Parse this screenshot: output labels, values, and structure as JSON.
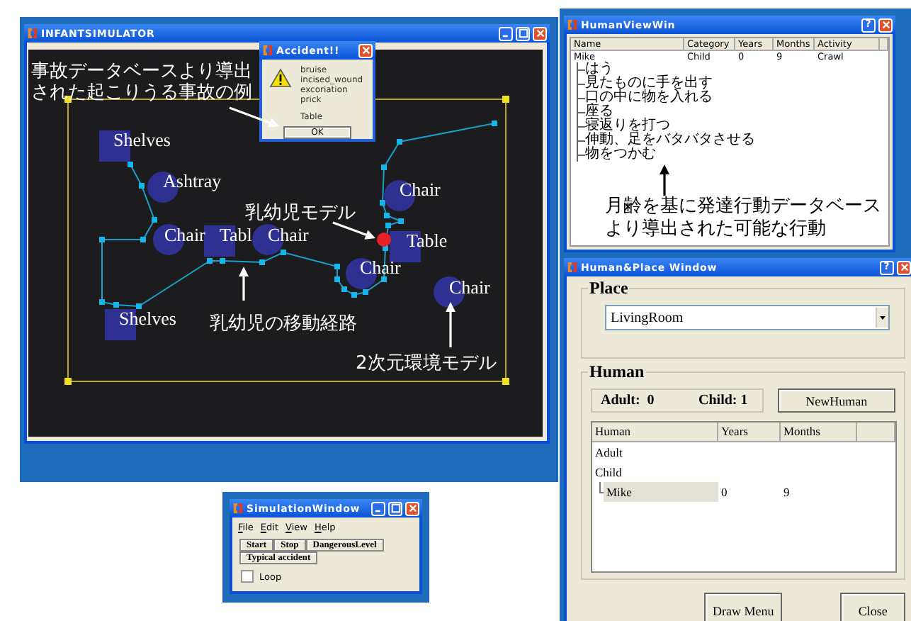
{
  "infant_simulator": {
    "title": "INFANTSIMULATOR",
    "objects": [
      {
        "kind": "square",
        "label": "Shelves"
      },
      {
        "kind": "circle",
        "label": "Ashtray"
      },
      {
        "kind": "circle",
        "label": "Chair"
      },
      {
        "kind": "square",
        "label": "Tabl"
      },
      {
        "kind": "circle",
        "label": "Chair"
      },
      {
        "kind": "circle",
        "label": "Chair"
      },
      {
        "kind": "square",
        "label": "Table"
      },
      {
        "kind": "circle",
        "label": "Chair"
      },
      {
        "kind": "circle",
        "label": "Chair"
      },
      {
        "kind": "square",
        "label": "Shelves"
      }
    ],
    "annotations": [
      "事故データベースより導出",
      "された起こりうる事故の例",
      "乳幼児モデル",
      "乳幼児の移動経路",
      "2次元環境モデル"
    ]
  },
  "accident_dialog": {
    "title": "Accident!!",
    "injuries": [
      "bruise",
      "incised_wound",
      "excoriation",
      "prick"
    ],
    "object": "Table",
    "ok_button": "OK"
  },
  "human_view_win": {
    "title": "HumanViewWin",
    "help_button": "?",
    "columns": [
      "Name",
      "Category",
      "Years",
      "Months",
      "Activity"
    ],
    "rows": [
      {
        "cells": [
          "Mike",
          "Child",
          "0",
          "9",
          "Crawl"
        ],
        "children": [
          "はう",
          "見たものに手を出す",
          "口の中に物を入れる",
          "座る",
          "寝返りを打つ",
          "伸動、足をバタバタさせる",
          "物をつかむ"
        ]
      }
    ],
    "annotation": [
      "月齢を基に発達行動データベース",
      "より導出された可能な行動"
    ]
  },
  "human_place_window": {
    "title": "Human&Place Window",
    "help_button": "?",
    "place_label": "Place",
    "place_value": "LivingRoom",
    "human_label": "Human",
    "adult_count": "Adult:  0",
    "child_count": "Child: 1",
    "new_human_button": "NewHuman",
    "columns": [
      "Human",
      "Years",
      "Months"
    ],
    "rows": [
      {
        "label": "Adult"
      },
      {
        "label": "Child",
        "children": [
          {
            "cells": [
              "Mike",
              "0",
              "9"
            ],
            "selected": true
          }
        ]
      }
    ],
    "buttons": [
      "Draw Menu",
      "Close"
    ]
  },
  "simulation_window": {
    "title": "SimulationWindow",
    "menu": [
      "File",
      "Edit",
      "View",
      "Help"
    ],
    "buttons": [
      "Start",
      "Stop",
      "DangerousLevel",
      "Typical accident"
    ],
    "loop": {
      "label": "Loop",
      "checked": false
    }
  }
}
